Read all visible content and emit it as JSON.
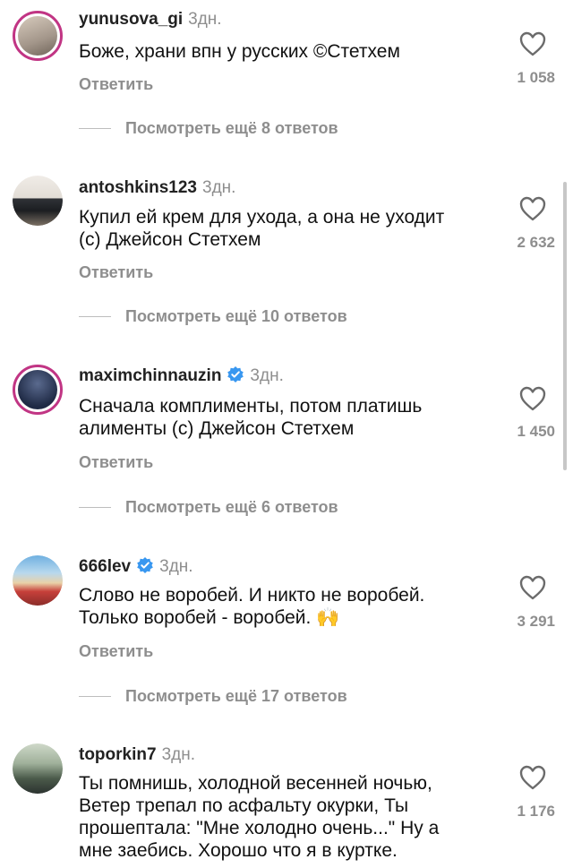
{
  "comments": [
    {
      "username": "yunusova_gi",
      "time": "3дн.",
      "verified": false,
      "text": "Боже, храни впн у русских ©Стетхем",
      "likes": "1 058",
      "reply": "Ответить",
      "more": "Посмотреть ещё 8 ответов"
    },
    {
      "username": "antoshkins123",
      "time": "3дн.",
      "verified": false,
      "text": "Купил ей крем для ухода, а она не уходит\n(с) Джейсон Стетхем",
      "likes": "2 632",
      "reply": "Ответить",
      "more": "Посмотреть ещё 10 ответов"
    },
    {
      "username": "maximchinnauzin",
      "time": "3дн.",
      "verified": true,
      "text": "Сначала комплименты, потом платишь\nалименты (с) Джейсон Стетхем",
      "likes": "1 450",
      "reply": "Ответить",
      "more": "Посмотреть ещё 6 ответов"
    },
    {
      "username": "666lev",
      "time": "3дн.",
      "verified": true,
      "text": "Слово не воробей. И никто не воробей.\nТолько воробей - воробей. 🙌",
      "likes": "3 291",
      "reply": "Ответить",
      "more": "Посмотреть ещё 17 ответов"
    },
    {
      "username": "toporkin7",
      "time": "3дн.",
      "verified": false,
      "text": "Ты помнишь, холодной весенней ночью,\nВетер трепал по асфальту окурки, Ты\nпрошептала: \"Мне холодно очень...\" Ну а\nмне заебись. Хорошо что я в куртке.",
      "likes": "1 176",
      "reply": "",
      "more": ""
    }
  ],
  "icons": {
    "like": "heart-outline-icon",
    "verified": "verified-badge-icon"
  },
  "colors": {
    "verified": "#3897f0",
    "muted": "#8e8e8e",
    "story_ring": "#c13584"
  }
}
